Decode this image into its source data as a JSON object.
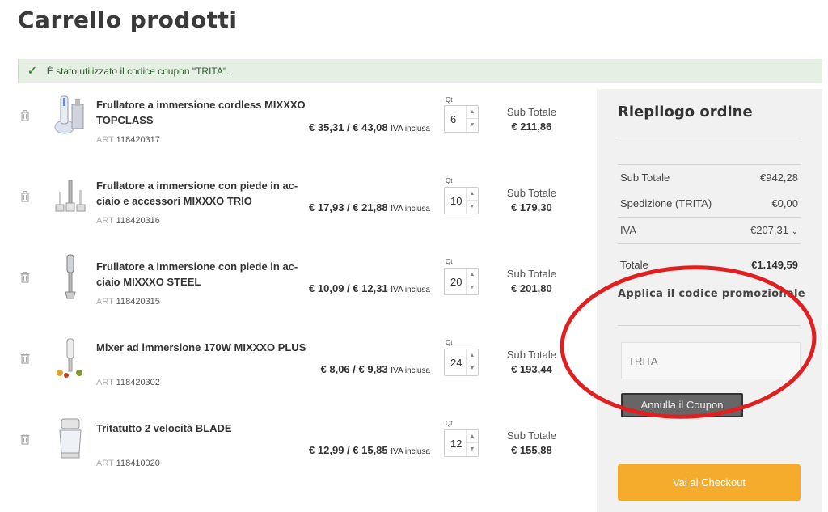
{
  "page": {
    "title": "Carrello prodotti",
    "notice": "È stato utilizzato il codice coupon \"TRITA\"."
  },
  "items": [
    {
      "name": "Frullatore a immersione cordless MIXXXO TOPCLASS",
      "art_label": "ART",
      "art": "118420317",
      "price": "€ 35,31 / € 43,08",
      "vat": "IVA inclusa",
      "qty_label": "Qt",
      "qty": "6",
      "sub_label": "Sub Totale",
      "sub": "€ 211,86"
    },
    {
      "name": "Frullatore a immersione con piede in ac-ciaio e accessori MIXXXO TRIO",
      "art_label": "ART",
      "art": "118420316",
      "price": "€ 17,93 / € 21,88",
      "vat": "IVA inclusa",
      "qty_label": "Qt",
      "qty": "10",
      "sub_label": "Sub Totale",
      "sub": "€ 179,30"
    },
    {
      "name": "Frullatore a immersione con piede in ac-ciaio MIXXXO STEEL",
      "art_label": "ART",
      "art": "118420315",
      "price": "€ 10,09 / € 12,31",
      "vat": "IVA inclusa",
      "qty_label": "Qt",
      "qty": "20",
      "sub_label": "Sub Totale",
      "sub": "€ 201,80"
    },
    {
      "name": "Mixer ad immersione 170W MIXXXO PLUS",
      "art_label": "ART",
      "art": "118420302",
      "price": "€ 8,06 / € 9,83",
      "vat": "IVA inclusa",
      "qty_label": "Qt",
      "qty": "24",
      "sub_label": "Sub Totale",
      "sub": "€ 193,44"
    },
    {
      "name": "Tritatutto 2 velocità BLADE",
      "art_label": "ART",
      "art": "118410020",
      "price": "€ 12,99 / € 15,85",
      "vat": "IVA inclusa",
      "qty_label": "Qt",
      "qty": "12",
      "sub_label": "Sub Totale",
      "sub": "€ 155,88"
    }
  ],
  "summary": {
    "title": "Riepilogo ordine",
    "subtotal_label": "Sub Totale",
    "subtotal": "€942,28",
    "shipping_label": "Spedizione (TRITA)",
    "shipping": "€0,00",
    "vat_label": "IVA",
    "vat": "€207,31",
    "total_label": "Totale",
    "total": "€1.149,59",
    "promo_title": "Applica il codice promozionale",
    "promo_placeholder": "TRITA",
    "cancel_label": "Annulla il Coupon",
    "checkout_label": "Vai al Checkout"
  },
  "colors": {
    "accent": "#f5ac2c",
    "notice_bg": "#e6efe3",
    "annotation": "#e02020"
  },
  "icons": [
    "check-icon",
    "trash-icon",
    "chevron-down-icon",
    "spinner-up-icon",
    "spinner-down-icon"
  ]
}
